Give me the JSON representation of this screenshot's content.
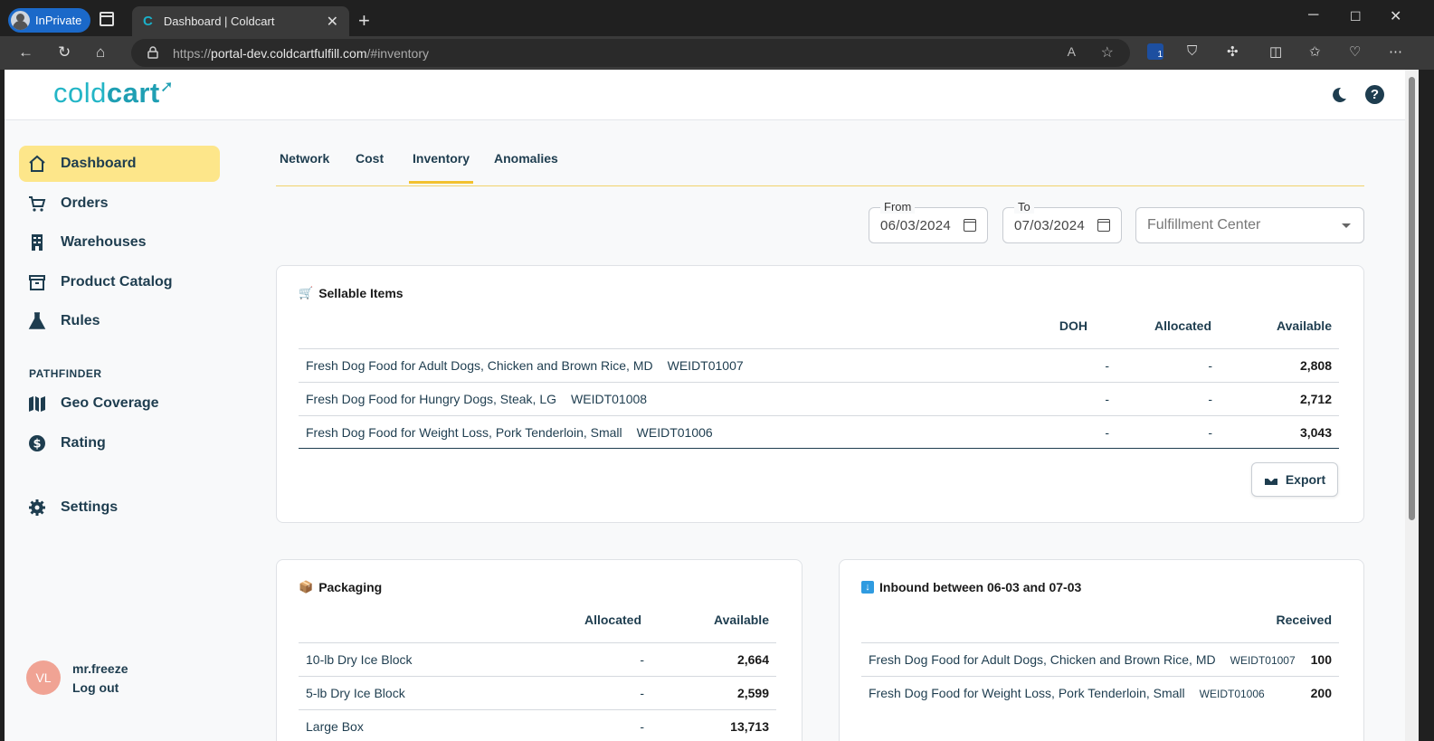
{
  "browser": {
    "inprivate_label": "InPrivate",
    "tab_title": "Dashboard | Coldcart",
    "tab_favicon": "C",
    "url_scheme": "https://",
    "url_host": "portal-dev.coldcartfulfill.com",
    "url_path": "/#inventory",
    "extension_badge": "1"
  },
  "app": {
    "logo_light": "cold",
    "logo_bold": "cart"
  },
  "sidebar": {
    "items": [
      {
        "label": "Dashboard",
        "icon": "home-icon"
      },
      {
        "label": "Orders",
        "icon": "cart-icon"
      },
      {
        "label": "Warehouses",
        "icon": "building-icon"
      },
      {
        "label": "Product Catalog",
        "icon": "archive-icon"
      },
      {
        "label": "Rules",
        "icon": "flask-icon"
      }
    ],
    "section_label": "PATHFINDER",
    "section_items": [
      {
        "label": "Geo Coverage",
        "icon": "map-icon"
      },
      {
        "label": "Rating",
        "icon": "dollar-icon"
      }
    ],
    "settings_label": "Settings",
    "user": {
      "initials": "VL",
      "name": "mr.freeze",
      "logout": "Log out"
    }
  },
  "tabs": [
    "Network",
    "Cost",
    "Inventory",
    "Anomalies"
  ],
  "filters": {
    "from_label": "From",
    "from_value": "06/03/2024",
    "to_label": "To",
    "to_value": "07/03/2024",
    "fc_placeholder": "Fulfillment Center"
  },
  "sellable": {
    "title": "Sellable Items",
    "headers": [
      "DOH",
      "Allocated",
      "Available"
    ],
    "rows": [
      {
        "name": "Fresh Dog Food for Adult Dogs, Chicken and Brown Rice, MD",
        "sku": "WEIDT01007",
        "doh": "-",
        "allocated": "-",
        "available": "2,808"
      },
      {
        "name": "Fresh Dog Food for Hungry Dogs, Steak, LG",
        "sku": "WEIDT01008",
        "doh": "-",
        "allocated": "-",
        "available": "2,712"
      },
      {
        "name": "Fresh Dog Food for Weight Loss, Pork Tenderloin, Small",
        "sku": "WEIDT01006",
        "doh": "-",
        "allocated": "-",
        "available": "3,043"
      }
    ],
    "export_label": "Export"
  },
  "packaging": {
    "title": "Packaging",
    "headers": [
      "Allocated",
      "Available"
    ],
    "rows": [
      {
        "name": "10-lb Dry Ice Block",
        "allocated": "-",
        "available": "2,664"
      },
      {
        "name": "5-lb Dry Ice Block",
        "allocated": "-",
        "available": "2,599"
      },
      {
        "name": "Large Box",
        "allocated": "-",
        "available": "13,713"
      }
    ]
  },
  "inbound": {
    "title": "Inbound between 06-03 and 07-03",
    "headers": [
      "Received"
    ],
    "rows": [
      {
        "name": "Fresh Dog Food for Adult Dogs, Chicken and Brown Rice, MD",
        "sku": "WEIDT01007",
        "received": "100"
      },
      {
        "name": "Fresh Dog Food for Weight Loss, Pork Tenderloin, Small",
        "sku": "WEIDT01006",
        "received": "200"
      }
    ]
  }
}
